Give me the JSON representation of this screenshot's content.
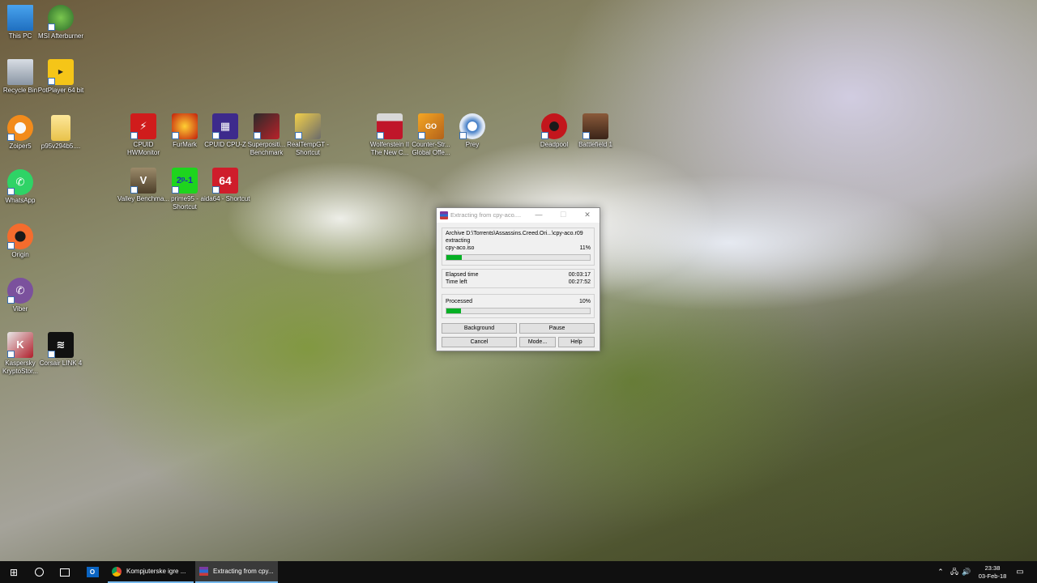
{
  "desktop": {
    "icons": [
      {
        "label": "This PC",
        "name": "this-pc-icon"
      },
      {
        "label": "MSI Afterburner",
        "name": "msi-afterburner-icon"
      },
      {
        "label": "Recycle Bin",
        "name": "recycle-bin-icon"
      },
      {
        "label": "PotPlayer 64 bit",
        "name": "potplayer-icon"
      },
      {
        "label": "Zoiper5",
        "name": "zoiper-icon"
      },
      {
        "label": "p95v294b5....",
        "name": "folder-icon"
      },
      {
        "label": "WhatsApp",
        "name": "whatsapp-icon"
      },
      {
        "label": "Origin",
        "name": "origin-icon"
      },
      {
        "label": "Viber",
        "name": "viber-icon"
      },
      {
        "label": "Kaspersky KryptoStor...",
        "name": "kaspersky-icon"
      },
      {
        "label": "Corsair LINK 4",
        "name": "corsair-icon"
      },
      {
        "label": "CPUID HWMonitor",
        "name": "hwmonitor-icon"
      },
      {
        "label": "FurMark",
        "name": "furmark-icon"
      },
      {
        "label": "CPUID CPU-Z",
        "name": "cpuz-icon"
      },
      {
        "label": "Superpositi... Benchmark",
        "name": "superposition-icon"
      },
      {
        "label": "RealTempGT - Shortcut",
        "name": "realtemp-icon"
      },
      {
        "label": "Valley Benchma...",
        "name": "valley-icon"
      },
      {
        "label": "prime95 - Shortcut",
        "name": "prime95-icon"
      },
      {
        "label": "aida64 - Shortcut",
        "name": "aida64-icon"
      },
      {
        "label": "Wolfenstein II The New C...",
        "name": "wolfenstein-icon"
      },
      {
        "label": "Counter-Str... Global Offe...",
        "name": "csgo-icon"
      },
      {
        "label": "Prey",
        "name": "prey-icon"
      },
      {
        "label": "Deadpool",
        "name": "deadpool-icon"
      },
      {
        "label": "Battlefield 1",
        "name": "battlefield-icon"
      }
    ]
  },
  "dialog": {
    "title": "Extracting from cpy-aco....",
    "minimize": "—",
    "maximize": "☐",
    "close": "✕",
    "archive_line": "Archive D:\\Torrents\\Assassins.Creed.Ori...\\cpy-aco.r09",
    "status": "extracting",
    "file": "cpy-aco.iso",
    "file_percent": "11%",
    "file_progress": 11,
    "elapsed_label": "Elapsed time",
    "elapsed_value": "00:03:17",
    "left_label": "Time left",
    "left_value": "00:27:52",
    "processed_label": "Processed",
    "processed_percent": "10%",
    "processed_progress": 10,
    "buttons": {
      "background": "Background",
      "pause": "Pause",
      "cancel": "Cancel",
      "mode": "Mode...",
      "help": "Help"
    }
  },
  "taskbar": {
    "tasks": [
      {
        "label": "Kompjuterske igre ...",
        "name": "chrome-task"
      },
      {
        "label": "Extracting from cpy...",
        "name": "winrar-task"
      }
    ],
    "time": "23:38",
    "date": "03-Feb-18"
  },
  "colors": {
    "progress": "#06b025",
    "taskbar": "#101010",
    "accent": "#76b9ed"
  }
}
